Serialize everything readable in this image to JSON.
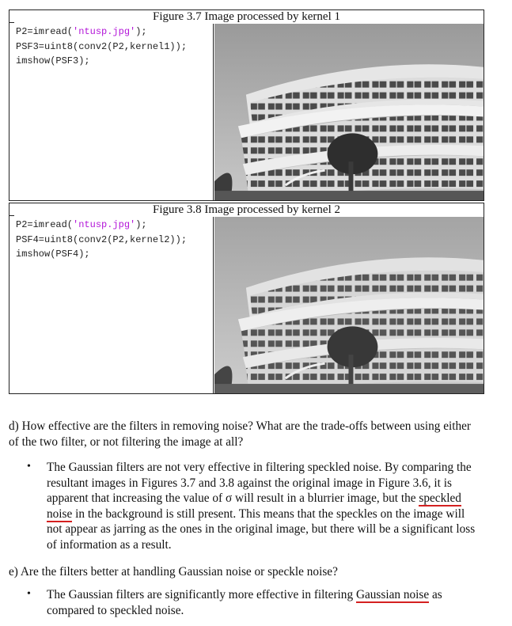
{
  "figures": [
    {
      "caption": "Figure 3.7 Image processed by kernel 1",
      "code": {
        "line1_prefix": "P2=imread(",
        "line1_string": "'ntusp.jpg'",
        "line1_suffix": ");",
        "line2": "PSF3=uint8(conv2(P2,kernel1));",
        "line3": "imshow(PSF3);"
      }
    },
    {
      "caption": "Figure 3.8 Image processed by kernel 2",
      "code": {
        "line1_prefix": "P2=imread(",
        "line1_string": "'ntusp.jpg'",
        "line1_suffix": ");",
        "line2": "PSF4=uint8(conv2(P2,kernel2));",
        "line3": "imshow(PSF4);"
      }
    }
  ],
  "question_d": "d) How effective are the filters in removing noise? What are the trade-offs between using either of the two filter, or not filtering the image at all?",
  "answer_d": {
    "bullet": "•",
    "part1": "The Gaussian filters are not very effective in filtering speckled noise. By comparing the resultant images in Figures 3.7 and 3.8 against the original image in Figure 3.6, it is apparent that increasing the value of σ will result in a blurrier image, but the ",
    "underlined": "speckled noise",
    "part2": " in the background is still present. This means that the speckles on the image will not appear as jarring as the ones in the original image, but there will be a significant loss of information as a result."
  },
  "question_e": "e) Are the filters better at handling Gaussian noise or speckle noise?",
  "answer_e": {
    "bullet": "•",
    "part1": "The Gaussian filters are significantly more effective in filtering ",
    "underlined": "Gaussian noise",
    "part2": " as compared to speckled noise."
  },
  "colors": {
    "string_literal": "#b316d8",
    "annotation_underline": "#d42020"
  }
}
